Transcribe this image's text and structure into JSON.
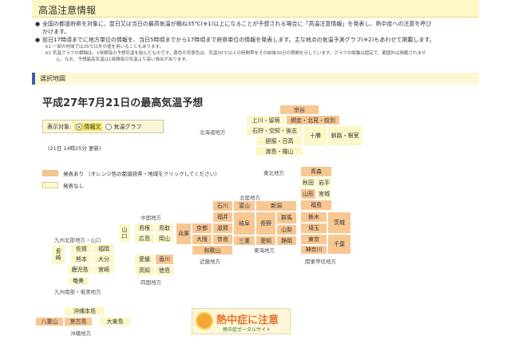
{
  "header": {
    "title": "高温注意情報"
  },
  "intro": {
    "lines": [
      "全国の都道府県を対象に、翌日又は当日の最高気温が概ね35℃(※1)以上になることが予想される場合に「高温注意情報」を発表し、熱中症への注意を呼び",
      "かけます。",
      "前日17時頃までに地方単位の情報を、当日5時頃までから17時頃まで府県単位の情報を発表します。主な地点の気温予測グラフ(※2)もあわせて掲載します。"
    ],
    "notes": [
      "※1 一部の地域では35℃以外の値を用いることもあります。",
      "※2 気温グラフの横軸は、1時間毎の予想気温を結んだものです。黄色の背景色は、気温30℃以上の時間帯をその前後30分の期間を示しています。グラフの縦軸は固定で、範囲外は掲載されませ",
      "ん。なお、予想最高気温は1時間毎の気温より高い場合があります。"
    ]
  },
  "section": {
    "label": "選択地図"
  },
  "map": {
    "title": "平成27年7月21日の最高気温予想",
    "target_label": "表示対象:",
    "option_info": "情報文",
    "option_graph": "気温グラフ",
    "updated": "(21日 14時25分 更新)",
    "legend_on": "発表あり （オレンジ色の都道府県・地域をクリックしてください）",
    "legend_off": "発表なし"
  },
  "regions": {
    "hokkaido": "北海道地方",
    "tohoku": "東北地方",
    "hokuriku": "北陸地方",
    "chugoku": "中国地方",
    "kyushu_north": "九州北部地方・山口",
    "kinki": "近畿地方",
    "tokai": "東海地方",
    "kanto": "関東甲信地方",
    "shikoku": "四国地方",
    "kyushu_south": "九州南部・奄美地方",
    "okinawa": "沖縄地方"
  },
  "prefectures": [
    {
      "name": "宗谷",
      "status": "on"
    },
    {
      "name": "上川・留萌",
      "status": "off"
    },
    {
      "name": "網走・北見・紋別",
      "status": "on"
    },
    {
      "name": "石狩・空知・後志",
      "status": "off"
    },
    {
      "name": "十勝",
      "status": "off"
    },
    {
      "name": "釧路・根室",
      "status": "off"
    },
    {
      "name": "胆振・日高",
      "status": "off"
    },
    {
      "name": "渡島・檜山",
      "status": "off"
    },
    {
      "name": "青森",
      "status": "on"
    },
    {
      "name": "秋田",
      "status": "off"
    },
    {
      "name": "岩手",
      "status": "off"
    },
    {
      "name": "山形",
      "status": "on"
    },
    {
      "name": "宮城",
      "status": "off"
    },
    {
      "name": "福島",
      "status": "on"
    },
    {
      "name": "石川",
      "status": "on"
    },
    {
      "name": "富山",
      "status": "on"
    },
    {
      "name": "新潟",
      "status": "on"
    },
    {
      "name": "福井",
      "status": "on"
    },
    {
      "name": "岐阜",
      "status": "on"
    },
    {
      "name": "長野",
      "status": "on"
    },
    {
      "name": "群馬",
      "status": "on"
    },
    {
      "name": "栃木",
      "status": "on"
    },
    {
      "name": "茨城",
      "status": "on"
    },
    {
      "name": "山梨",
      "status": "on"
    },
    {
      "name": "埼玉",
      "status": "on"
    },
    {
      "name": "東京",
      "status": "on"
    },
    {
      "name": "千葉",
      "status": "on"
    },
    {
      "name": "神奈川",
      "status": "on"
    },
    {
      "name": "愛知",
      "status": "on"
    },
    {
      "name": "静岡",
      "status": "on"
    },
    {
      "name": "三重",
      "status": "on"
    },
    {
      "name": "京都",
      "status": "on"
    },
    {
      "name": "滋賀",
      "status": "on"
    },
    {
      "name": "兵庫",
      "status": "on"
    },
    {
      "name": "大阪",
      "status": "on"
    },
    {
      "name": "奈良",
      "status": "on"
    },
    {
      "name": "和歌山",
      "status": "on"
    },
    {
      "name": "鳥取",
      "status": "off"
    },
    {
      "name": "島根",
      "status": "off"
    },
    {
      "name": "岡山",
      "status": "off"
    },
    {
      "name": "広島",
      "status": "off"
    },
    {
      "name": "山口",
      "status": "off"
    },
    {
      "name": "香川",
      "status": "on"
    },
    {
      "name": "愛媛",
      "status": "off"
    },
    {
      "name": "徳島",
      "status": "off"
    },
    {
      "name": "高知",
      "status": "off"
    },
    {
      "name": "福岡",
      "status": "off"
    },
    {
      "name": "佐賀",
      "status": "off"
    },
    {
      "name": "長崎",
      "status": "off"
    },
    {
      "name": "熊本",
      "status": "off"
    },
    {
      "name": "大分",
      "status": "off"
    },
    {
      "name": "宮崎",
      "status": "off"
    },
    {
      "name": "鹿児島",
      "status": "off"
    },
    {
      "name": "奄美",
      "status": "off"
    },
    {
      "name": "沖縄本島",
      "status": "off"
    },
    {
      "name": "八重山",
      "status": "on"
    },
    {
      "name": "宮古島",
      "status": "on"
    },
    {
      "name": "大東島",
      "status": "off"
    }
  ],
  "banner": {
    "title": "熱中症に注意",
    "subtitle": "熱中症ポータルサイト"
  },
  "colors": {
    "on": "#f8c792",
    "off": "#fbf8c8",
    "accent": "#3b5ea8"
  }
}
